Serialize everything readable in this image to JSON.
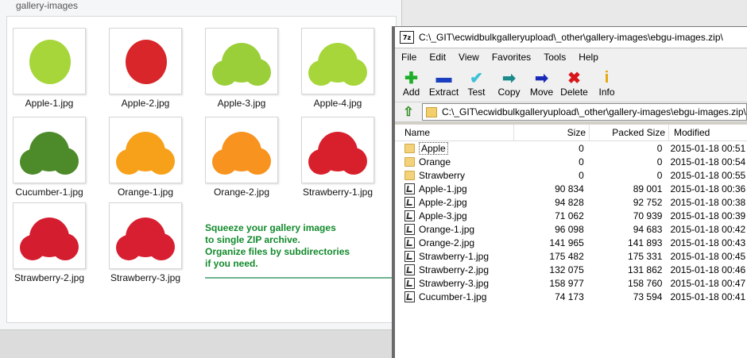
{
  "explorer": {
    "folder_title": "gallery-images",
    "thumbnails": [
      {
        "label": "Apple-1.jpg",
        "color": "#a6d63a"
      },
      {
        "label": "Apple-2.jpg",
        "color": "#d8262a"
      },
      {
        "label": "Apple-3.jpg",
        "color": "#9bcf3a"
      },
      {
        "label": "Apple-4.jpg",
        "color": "#a6d63a"
      },
      {
        "label": "Cucumber-1.jpg",
        "color": "#4c8a2a"
      },
      {
        "label": "Orange-1.jpg",
        "color": "#f7a11a"
      },
      {
        "label": "Orange-2.jpg",
        "color": "#f7931e"
      },
      {
        "label": "Strawberry-1.jpg",
        "color": "#d8202c"
      },
      {
        "label": "Strawberry-2.jpg",
        "color": "#d51d30"
      },
      {
        "label": "Strawberry-3.jpg",
        "color": "#d81f31"
      }
    ]
  },
  "promo": {
    "line1": "Squeeze your gallery images",
    "line2": "to single ZIP archive.",
    "line3": "Organize files by subdirectories",
    "line4": "if you need."
  },
  "zip": {
    "app_icon": "7z",
    "title": "C:\\_GIT\\ecwidbulkgalleryupload\\_other\\gallery-images\\ebgu-images.zip\\",
    "menu": [
      "File",
      "Edit",
      "View",
      "Favorites",
      "Tools",
      "Help"
    ],
    "toolbar": [
      {
        "label": "Add",
        "icon": "plus-icon",
        "glyph": "✚",
        "color": "#1fae2a"
      },
      {
        "label": "Extract",
        "icon": "minus-icon",
        "glyph": "▬",
        "color": "#1b3fbf"
      },
      {
        "label": "Test",
        "icon": "check-icon",
        "glyph": "✔",
        "color": "#3cc2d8"
      },
      {
        "label": "Copy",
        "icon": "copy-arrow-icon",
        "glyph": "➡",
        "color": "#1b8a8a"
      },
      {
        "label": "Move",
        "icon": "move-arrow-icon",
        "glyph": "➡",
        "color": "#1a2ab8"
      },
      {
        "label": "Delete",
        "icon": "delete-x-icon",
        "glyph": "✖",
        "color": "#d8151a"
      },
      {
        "label": "Info",
        "icon": "info-icon",
        "glyph": "i",
        "color": "#e6a400"
      }
    ],
    "address": "C:\\_GIT\\ecwidbulkgalleryupload\\_other\\gallery-images\\ebgu-images.zip\\",
    "columns": {
      "name": "Name",
      "size": "Size",
      "packed": "Packed Size",
      "modified": "Modified"
    },
    "rows": [
      {
        "name": "Apple",
        "type": "folder",
        "size": "0",
        "packed": "0",
        "modified": "2015-01-18 00:51"
      },
      {
        "name": "Orange",
        "type": "folder",
        "size": "0",
        "packed": "0",
        "modified": "2015-01-18 00:54"
      },
      {
        "name": "Strawberry",
        "type": "folder",
        "size": "0",
        "packed": "0",
        "modified": "2015-01-18 00:55"
      },
      {
        "name": "Apple-1.jpg",
        "type": "file",
        "size": "90 834",
        "packed": "89 001",
        "modified": "2015-01-18 00:36"
      },
      {
        "name": "Apple-2.jpg",
        "type": "file",
        "size": "94 828",
        "packed": "92 752",
        "modified": "2015-01-18 00:38"
      },
      {
        "name": "Apple-3.jpg",
        "type": "file",
        "size": "71 062",
        "packed": "70 939",
        "modified": "2015-01-18 00:39"
      },
      {
        "name": "Orange-1.jpg",
        "type": "file",
        "size": "96 098",
        "packed": "94 683",
        "modified": "2015-01-18 00:42"
      },
      {
        "name": "Orange-2.jpg",
        "type": "file",
        "size": "141 965",
        "packed": "141 893",
        "modified": "2015-01-18 00:43"
      },
      {
        "name": "Strawberry-1.jpg",
        "type": "file",
        "size": "175 482",
        "packed": "175 331",
        "modified": "2015-01-18 00:45"
      },
      {
        "name": "Strawberry-2.jpg",
        "type": "file",
        "size": "132 075",
        "packed": "131 862",
        "modified": "2015-01-18 00:46"
      },
      {
        "name": "Strawberry-3.jpg",
        "type": "file",
        "size": "158 977",
        "packed": "158 760",
        "modified": "2015-01-18 00:47"
      },
      {
        "name": "Cucumber-1.jpg",
        "type": "file",
        "size": "74 173",
        "packed": "73 594",
        "modified": "2015-01-18 00:41"
      }
    ]
  }
}
